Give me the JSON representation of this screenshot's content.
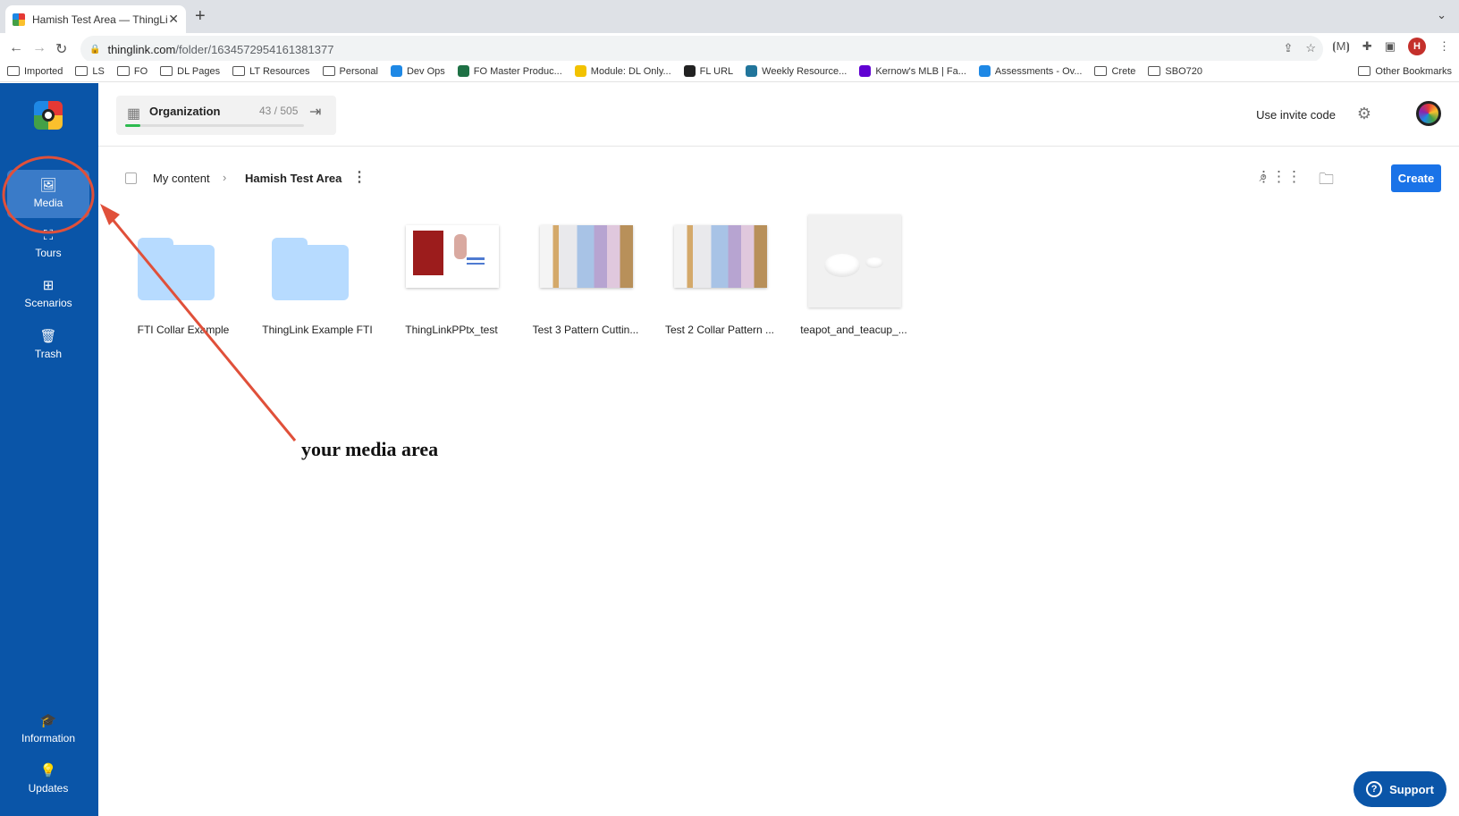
{
  "browser": {
    "tab_title": "Hamish Test Area — ThingLink",
    "url_domain": "thinglink.com",
    "url_path": "/folder/1634572954161381377",
    "profile_initial": "H",
    "bookmarks": [
      {
        "label": "Imported",
        "icon": "folder-icon"
      },
      {
        "label": "LS",
        "icon": "folder-icon"
      },
      {
        "label": "FO",
        "icon": "folder-icon"
      },
      {
        "label": "DL Pages",
        "icon": "folder-icon"
      },
      {
        "label": "LT Resources",
        "icon": "folder-icon"
      },
      {
        "label": "Personal",
        "icon": "folder-icon"
      },
      {
        "label": "Dev Ops",
        "icon": "devops-icon",
        "color": "#1e88e5"
      },
      {
        "label": "FO Master Produc...",
        "icon": "excel-icon",
        "color": "#1e7145"
      },
      {
        "label": "Module: DL Only...",
        "icon": "ls-icon",
        "color": "#f2c200"
      },
      {
        "label": "FL URL",
        "icon": "f-icon",
        "color": "#222222"
      },
      {
        "label": "Weekly Resource...",
        "icon": "wordpress-icon",
        "color": "#21759b"
      },
      {
        "label": "Kernow's MLB | Fa...",
        "icon": "yahoo-icon",
        "color": "#6001d2"
      },
      {
        "label": "Assessments - Ov...",
        "icon": "devops-icon",
        "color": "#1e88e5"
      },
      {
        "label": "Crete",
        "icon": "folder-icon"
      },
      {
        "label": "SBO720",
        "icon": "folder-icon"
      }
    ],
    "other_bookmarks": "Other Bookmarks"
  },
  "sidebar": {
    "items": [
      {
        "label": "Media",
        "icon": "media-icon"
      },
      {
        "label": "Tours",
        "icon": "tours-icon"
      },
      {
        "label": "Scenarios",
        "icon": "scenarios-icon"
      },
      {
        "label": "Trash",
        "icon": "trash-icon"
      }
    ],
    "bottom_items": [
      {
        "label": "Information",
        "icon": "graduation-cap-icon"
      },
      {
        "label": "Updates",
        "icon": "lightbulb-icon"
      }
    ]
  },
  "header": {
    "org_name": "Organization",
    "org_count": "43 / 505",
    "org_usage_fraction": 0.085,
    "invite": "Use invite code"
  },
  "toolbar": {
    "crumb_root": "My content",
    "crumb_current": "Hamish Test Area",
    "create": "Create"
  },
  "items": [
    {
      "label": "FTI Collar Example",
      "kind": "folder"
    },
    {
      "label": "ThingLink Example FTI",
      "kind": "folder"
    },
    {
      "label": "ThingLinkPPtx_test",
      "kind": "presentation"
    },
    {
      "label": "Test 3 Pattern Cuttin...",
      "kind": "image"
    },
    {
      "label": "Test 2 Collar Pattern ...",
      "kind": "image"
    },
    {
      "label": "teapot_and_teacup_...",
      "kind": "model"
    }
  ],
  "annotation": {
    "text": "your media area",
    "color": "#e0503a"
  },
  "support": "Support"
}
